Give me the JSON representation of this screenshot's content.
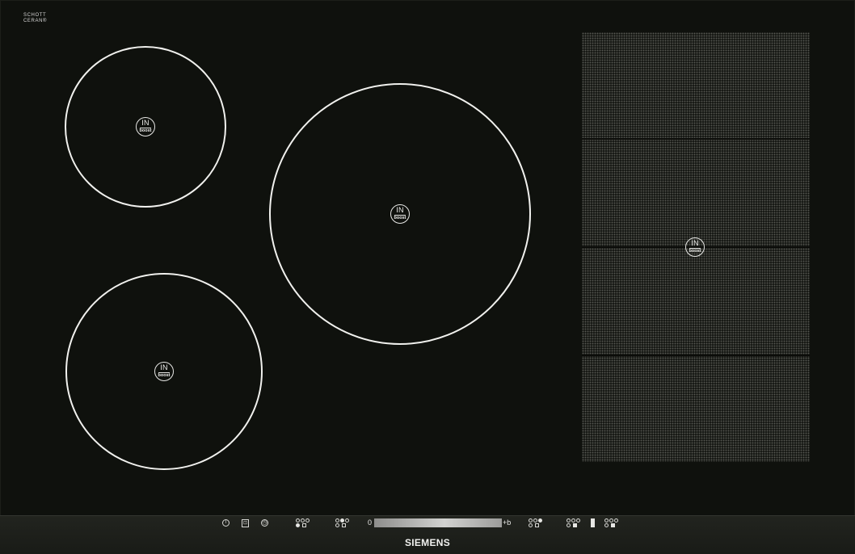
{
  "glass_mark": {
    "line1": "SCHOTT",
    "line2": "CERAN®",
    "line3": ""
  },
  "zone_marking": {
    "top": "IN",
    "bottom": "boost"
  },
  "cooking_zones": [
    {
      "id": "front-left",
      "top": "IN",
      "bottom": "boost"
    },
    {
      "id": "rear-left",
      "top": "IN",
      "bottom": "boost"
    },
    {
      "id": "center",
      "top": "IN",
      "bottom": "boost"
    },
    {
      "id": "flex",
      "top": "IN",
      "bottom": "boost"
    }
  ],
  "controls": {
    "power_symbol": "I",
    "lock_symbol": "⊡",
    "timer_symbol": "◷",
    "slider": {
      "min_label": "0",
      "max_label": "+b"
    }
  },
  "brand": "SIEMENS",
  "colors": {
    "glass": "#0f110d",
    "marking": "#f1f1ee",
    "flex_dots": "#565851",
    "slider": "#c9c9c7"
  }
}
